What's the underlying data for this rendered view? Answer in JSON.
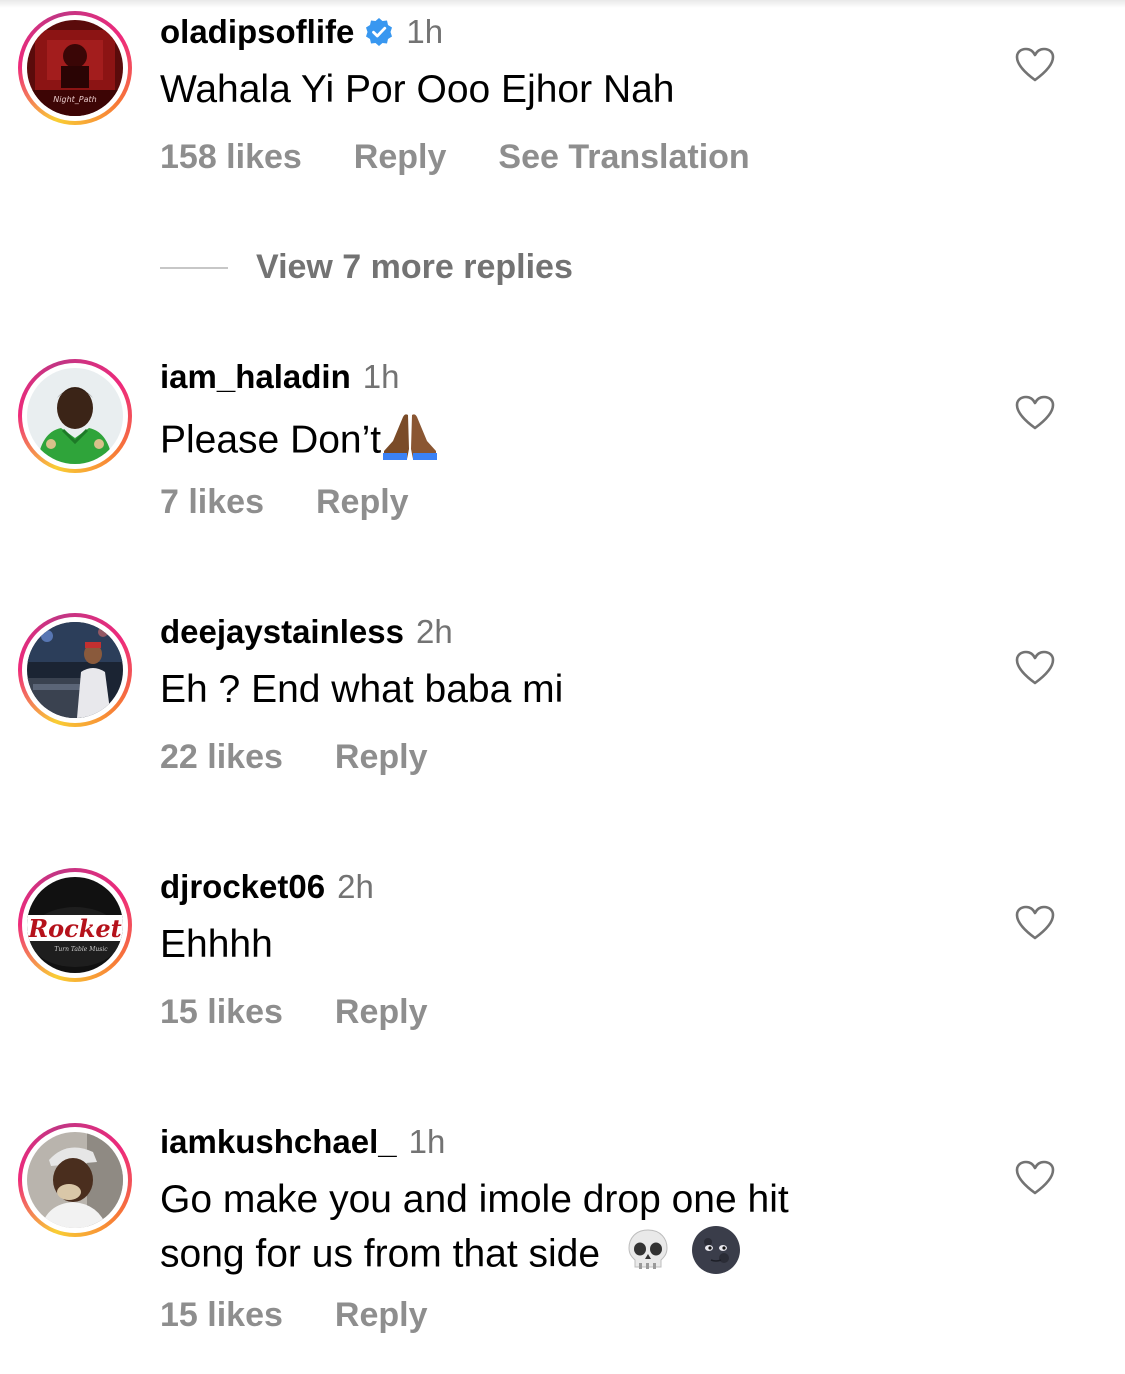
{
  "comments": [
    {
      "username": "oladipsoflife",
      "verified": true,
      "time": "1h",
      "text": "Wahala Yi Por Ooo Ejhor Nah",
      "likes": "158 likes",
      "reply": "Reply",
      "translation": "See Translation",
      "avatar_caption": "Night_Path"
    },
    {
      "username": "iam_haladin",
      "time": "1h",
      "text": "Please Don’t",
      "likes": "7 likes",
      "reply": "Reply"
    },
    {
      "username": "deejaystainless",
      "time": "2h",
      "text": "Eh ? End what baba mi",
      "likes": "22 likes",
      "reply": "Reply"
    },
    {
      "username": "djrocket06",
      "time": "2h",
      "text": "Ehhhh",
      "likes": "15 likes",
      "reply": "Reply",
      "avatar_logo_text": "Rocket",
      "avatar_sub_text": "Turn Table Music"
    },
    {
      "username": "iamkushchael_",
      "time": "1h",
      "text_line1": "Go make you and imole drop one hit",
      "text_line2": "song for us from that side",
      "likes": "15 likes",
      "reply": "Reply"
    }
  ],
  "view_replies": "View 7 more replies",
  "icons": {
    "like": "heart-outline-icon",
    "verified": "verified-badge-icon",
    "emoji_pray": "folded-hands-emoji",
    "emoji_skull": "skull-emoji",
    "emoji_moon": "new-moon-face-emoji"
  },
  "colors": {
    "text": "#000000",
    "secondary": "#737373",
    "action": "#8e8e8e",
    "verified": "#3897f0"
  }
}
